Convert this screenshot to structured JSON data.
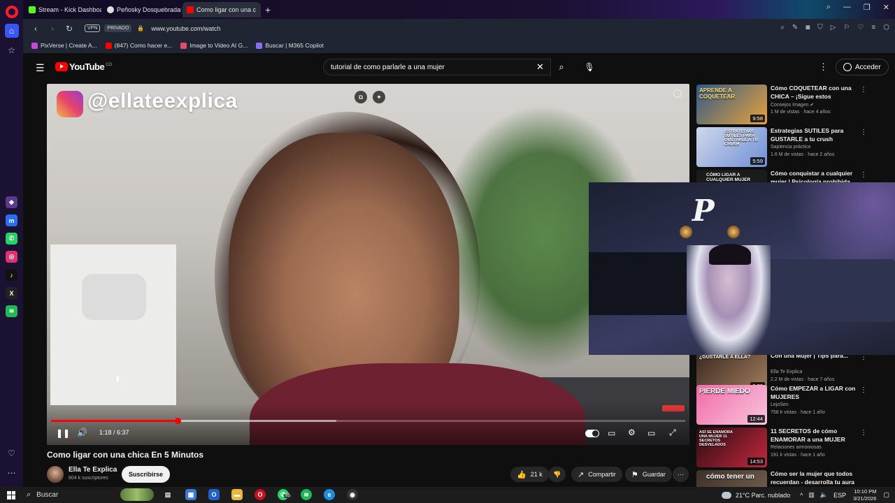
{
  "browser": {
    "tabs": [
      {
        "label": "Stream - Kick Dashboard",
        "favicon_color": "#53fc18",
        "active": false
      },
      {
        "label": "Peñosky Dosquebradas, P",
        "favicon_color": "#e0e0e0",
        "active": false
      },
      {
        "label": "Como ligar con una c",
        "favicon_color": "#ff0000",
        "active": true
      }
    ],
    "vpn_label": "VPN",
    "private_label": "PRIVADO",
    "url": "www.youtube.com/watch",
    "bookmarks": [
      {
        "label": "PixVerse | Create A...",
        "color": "#c04bd8"
      },
      {
        "label": "(847) Como hacer e...",
        "color": "#ff0000"
      },
      {
        "label": "Image to Video AI G...",
        "color": "#e34b6a"
      },
      {
        "label": "Buscar | M365 Copilot",
        "color": "#8a6ef0"
      }
    ]
  },
  "youtube": {
    "logo_text": "YouTube",
    "logo_region": "CO",
    "search_query": "tutorial de como parlarle a una mujer",
    "signin_label": "Acceder",
    "player": {
      "overlay_handle": "@ellateexplica",
      "time": "1:18 / 6:37",
      "progress_fraction": 0.2,
      "buffered_fraction": 0.45
    },
    "video_title": "Como ligar con una chica En 5 Minutos",
    "channel": {
      "name": "Ella Te Explica",
      "subscribers": "604 k suscriptores"
    },
    "subscribe_label": "Suscribirse",
    "actions": {
      "likes": "21 k",
      "share": "Compartir",
      "save": "Guardar"
    },
    "recommendations": [
      {
        "title": "Cómo COQUETEAR con una CHICA – ¡Sigue estos TRUCOS!",
        "channel": "Consejos Imagen ✔",
        "meta": "1 M de vistas · hace 4 años",
        "duration": "9:58",
        "thumb_text": "APRENDE A COQUETEAR",
        "thumb_color": "#e9a33a"
      },
      {
        "title": "Estrategias SUTILES  para GUSTARLE a tu crush",
        "channel": "Sapiencia práctica",
        "meta": "1.6 M de vistas · hace 2 años",
        "duration": "5:59",
        "thumb_text": "ESTRATEGIAS SUTILES PARA GUSTARLE A TU CRUSH",
        "thumb_color": "#3b6fd0"
      },
      {
        "title": "Cómo conquistar a cualquier mujer | Psicología prohibida",
        "channel": "",
        "meta": "",
        "duration": "",
        "thumb_text": "CÓMO LIGAR A CUALQUIER MUJER",
        "thumb_color": "#1b1b1b"
      },
      {
        "title": "Con una Mujer | Tips para...",
        "channel": "Ella Te Explica",
        "meta": "2.2 M de vistas · hace 7 años",
        "duration": "9:29",
        "thumb_text": "¿GUSTARLE A ELLA?",
        "thumb_color": "#7a5a3c"
      },
      {
        "title": "Cómo EMPEZAR a LIGAR con MUJERES",
        "channel": "LejoSen",
        "meta": "758 k vistas · hace 1 año",
        "duration": "12:44",
        "thumb_text": "PIERDE MIEDO",
        "thumb_color": "#d64a8a"
      },
      {
        "title": "11 SECRETOS de cómo ENAMORAR a una MUJER",
        "channel": "Relaciones armoniosas",
        "meta": "191 k vistas · hace 1 año",
        "duration": "14:53",
        "thumb_text": "ASÍ SE ENAMORA UNA MUJER 11 SECRETOS DESVELADOS",
        "thumb_color": "#8a1e2c"
      },
      {
        "title": "Cómo ser la mujer que todos recuerdan - desarrolla tu aura",
        "channel": "",
        "meta": "",
        "duration": "",
        "thumb_text": "cómo tener un",
        "thumb_color": "#5a4a3a"
      }
    ]
  },
  "taskbar": {
    "search_label": "Buscar",
    "whatsapp_badge": "85",
    "weather": "21°C  Parc. nublado",
    "language": "ESP",
    "time": "10:10 PM",
    "date": "3/21/2026"
  }
}
